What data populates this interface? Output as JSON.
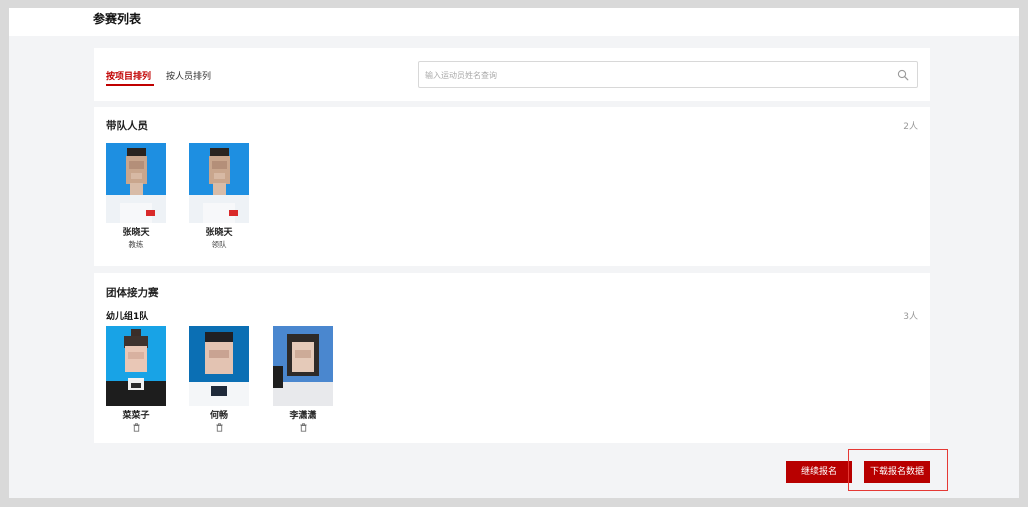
{
  "page": {
    "title": "参赛列表"
  },
  "tabs": [
    {
      "label": "按项目排列",
      "active": true
    },
    {
      "label": "按人员排列",
      "active": false
    }
  ],
  "search": {
    "placeholder": "输入运动员姓名查询",
    "value": ""
  },
  "leaders": {
    "title": "带队人员",
    "count": "2人",
    "members": [
      {
        "name": "张晓天",
        "role": "教练"
      },
      {
        "name": "张晓天",
        "role": "领队"
      }
    ]
  },
  "relay": {
    "title": "团体接力赛",
    "team_name": "幼儿组1队",
    "count": "3人",
    "members": [
      {
        "name": "菜菜子"
      },
      {
        "name": "何畅"
      },
      {
        "name": "李潇潇"
      }
    ]
  },
  "actions": {
    "continue_label": "继续报名",
    "download_label": "下载报名数据"
  },
  "colors": {
    "accent": "#b80000",
    "active_tab": "#c00000",
    "highlight": "#e53935"
  }
}
